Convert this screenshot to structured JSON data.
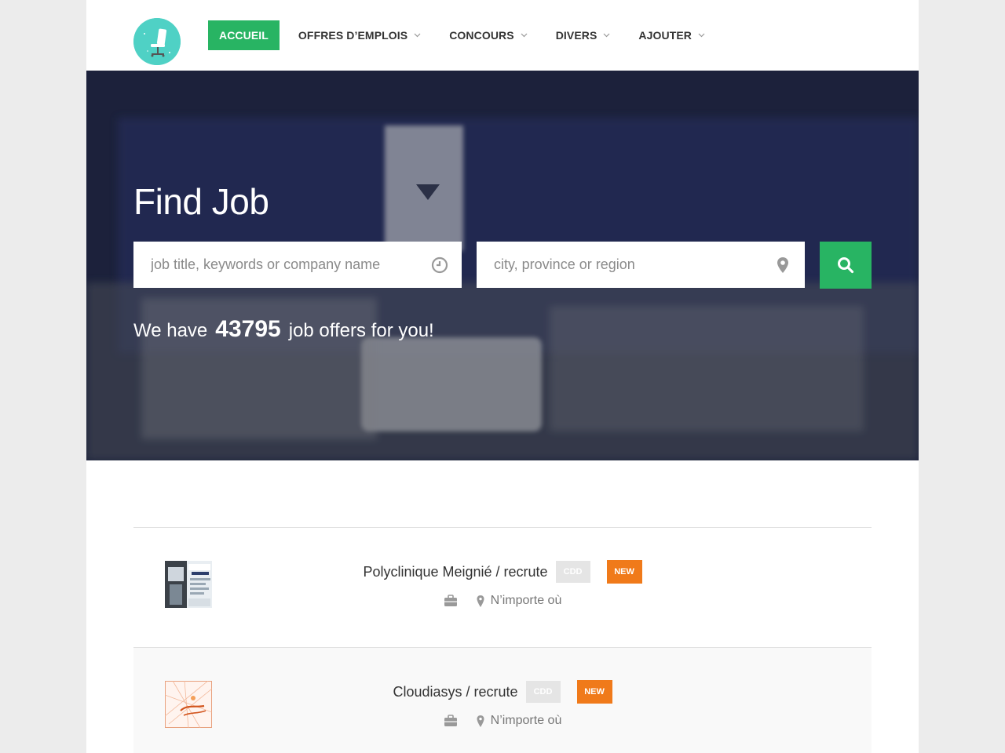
{
  "nav": {
    "items": [
      {
        "label": "ACCUEIL",
        "active": true,
        "has_caret": false
      },
      {
        "label": "OFFRES D’EMPLOIS",
        "active": false,
        "has_caret": true
      },
      {
        "label": "CONCOURS",
        "active": false,
        "has_caret": true
      },
      {
        "label": "DIVERS",
        "active": false,
        "has_caret": true
      },
      {
        "label": "AJOUTER",
        "active": false,
        "has_caret": true
      }
    ]
  },
  "hero": {
    "title": "Find Job",
    "search": {
      "keyword_placeholder": "job title, keywords or company name",
      "location_placeholder": "city, province or region",
      "keyword_icon": "clock-icon",
      "location_icon": "map-pin-icon",
      "button_icon": "search-icon"
    },
    "offers_prefix": "We have",
    "offers_count": "43795",
    "offers_suffix": "job offers for you!"
  },
  "listings": [
    {
      "title": "Polyclinique Meignié / recrute",
      "type": "CDD",
      "badge": "NEW",
      "location": "N’importe où"
    },
    {
      "title": "Cloudiasys / recrute",
      "type": "CDD",
      "badge": "NEW",
      "location": "N’importe où"
    }
  ],
  "colors": {
    "accent": "#28b463",
    "new_badge": "#f07a1a",
    "cdd_badge": "#e5e5e5",
    "logo_bg": "#4fd1c5"
  }
}
